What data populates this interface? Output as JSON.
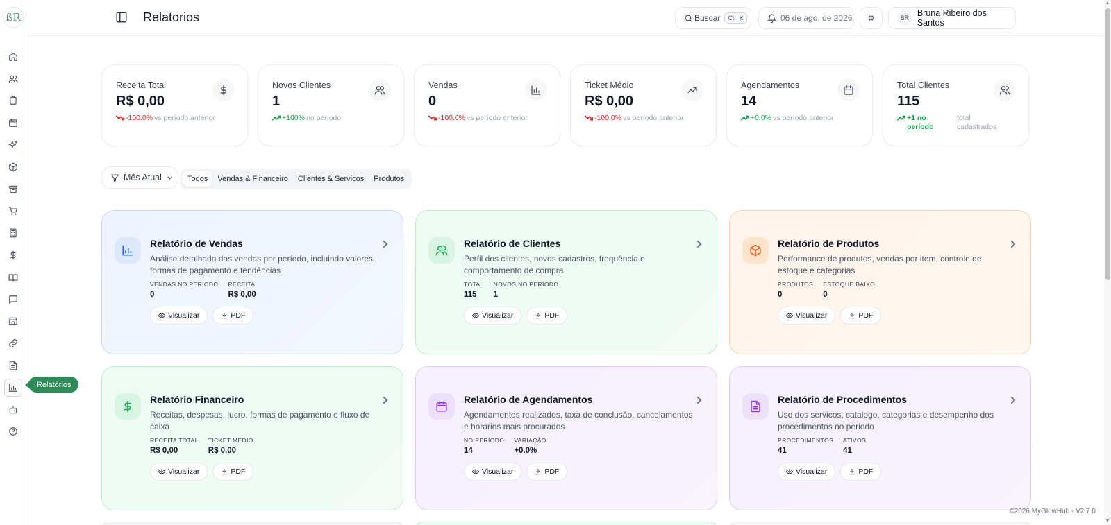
{
  "app": {
    "logo_text": "ßR",
    "page_title": "Relatorios"
  },
  "header": {
    "search_label": "Buscar",
    "search_shortcut": "Ctrl K",
    "date": "06 de ago. de 2026",
    "gear_glyph": "⚙",
    "user_initials": "BR",
    "user_name": "Bruna Ribeiro dos Santos"
  },
  "sidebar": {
    "items": [
      {
        "icon": "home-icon"
      },
      {
        "icon": "users-icon"
      },
      {
        "icon": "clipboard-icon"
      },
      {
        "icon": "calendar-icon"
      },
      {
        "icon": "sparkles-icon"
      },
      {
        "icon": "package-icon"
      },
      {
        "icon": "archive-icon"
      },
      {
        "icon": "cart-icon"
      },
      {
        "icon": "calculator-icon"
      },
      {
        "icon": "dollar-icon"
      },
      {
        "icon": "book-icon"
      },
      {
        "icon": "message-icon"
      },
      {
        "icon": "store-icon"
      },
      {
        "icon": "link-icon"
      },
      {
        "icon": "file-icon"
      },
      {
        "icon": "bar-chart-icon"
      },
      {
        "icon": "bot-icon"
      },
      {
        "icon": "help-icon"
      }
    ],
    "active_tooltip": "Relatórios"
  },
  "metrics": [
    {
      "label": "Receita Total",
      "value": "R$ 0,00",
      "trend_value": "-100.0%",
      "trend_text": "vs período anterior",
      "direction": "down",
      "icon": "dollar-icon"
    },
    {
      "label": "Novos Clientes",
      "value": "1",
      "trend_value": "+100%",
      "trend_text": "no período",
      "direction": "up",
      "icon": "users-icon"
    },
    {
      "label": "Vendas",
      "value": "0",
      "trend_value": "-100.0%",
      "trend_text": "vs período anterior",
      "direction": "down",
      "icon": "bar-chart-icon"
    },
    {
      "label": "Ticket Médio",
      "value": "R$ 0,00",
      "trend_value": "-100.0%",
      "trend_text": "vs período anterior",
      "direction": "down",
      "icon": "trending-up-icon"
    },
    {
      "label": "Agendamentos",
      "value": "14",
      "trend_value": "+0.0%",
      "trend_text": "vs período anterior",
      "direction": "up",
      "icon": "calendar-icon"
    },
    {
      "label": "Total Clientes",
      "value": "115",
      "trend_value": "+1 no período",
      "trend_text": "total cadastrados",
      "direction": "up",
      "icon": "users-icon"
    }
  ],
  "filters": {
    "period_label": "Mês Atual",
    "tabs": [
      "Todos",
      "Vendas & Financeiro",
      "Clientes & Servicos",
      "Produtos"
    ],
    "active_tab": 0
  },
  "reports": [
    {
      "title": "Relatório de Vendas",
      "desc": "Análise detalhada das vendas por período, incluindo valores, formas de pagamento e tendências",
      "color": "#2563eb",
      "stats": [
        {
          "label": "Vendas no período",
          "value": "0"
        },
        {
          "label": "Receita",
          "value": "R$ 0,00"
        }
      ]
    },
    {
      "title": "Relatório de Clientes",
      "desc": "Perfil dos clientes, novos cadastros, frequência e comportamento de compra",
      "color": "#16a34a",
      "stats": [
        {
          "label": "Total",
          "value": "115"
        },
        {
          "label": "Novos no período",
          "value": "1"
        }
      ]
    },
    {
      "title": "Relatório de Produtos",
      "desc": "Performance de produtos, vendas por item, controle de estoque e categorias",
      "color": "#ea580c",
      "stats": [
        {
          "label": "Produtos",
          "value": "0"
        },
        {
          "label": "Estoque baixo",
          "value": "0"
        }
      ]
    },
    {
      "title": "Relatório Financeiro",
      "desc": "Receitas, despesas, lucro, formas de pagamento e fluxo de caixa",
      "color": "#16a34a",
      "stats": [
        {
          "label": "Receita total",
          "value": "R$ 0,00"
        },
        {
          "label": "Ticket médio",
          "value": "R$ 0,00"
        }
      ]
    },
    {
      "title": "Relatório de Agendamentos",
      "desc": "Agendamentos realizados, taxa de conclusão, cancelamentos e horários mais procurados",
      "color": "#9333ea",
      "stats": [
        {
          "label": "No período",
          "value": "14"
        },
        {
          "label": "Variação",
          "value": "+0.0%"
        }
      ]
    },
    {
      "title": "Relatório de Procedimentos",
      "desc": "Uso dos servicos, catalogo, categorias e desempenho dos procedimentos no periodo",
      "color": "#9333ea",
      "stats": [
        {
          "label": "Procedimentos",
          "value": "41"
        },
        {
          "label": "Ativos",
          "value": "41"
        }
      ]
    }
  ],
  "actions": {
    "view_label": "Visualizar",
    "pdf_label": "PDF"
  },
  "footer": {
    "text": "©2026 MyGlowHub - V2.7.0"
  }
}
